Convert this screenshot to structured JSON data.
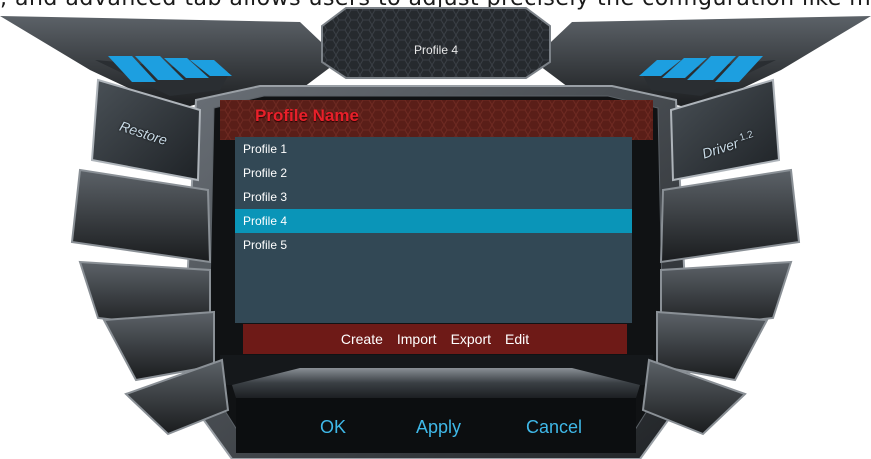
{
  "top_partial_text": ", and advanced tab allows users to adjust precisely the configuration like mouse polling rate, key respond time, cursor p",
  "header": {
    "active_profile": "Profile 4"
  },
  "left_buttons": {
    "restore_label": "Restore"
  },
  "right_buttons": {
    "driver_label": "Driver",
    "driver_version": "1.2"
  },
  "panel": {
    "title": "Profile Name",
    "profiles": [
      "Profile 1",
      "Profile 2",
      "Profile 3",
      "Profile 4",
      "Profile 5"
    ],
    "selected": "Profile 4"
  },
  "actions": {
    "create": "Create",
    "import": "Import",
    "export": "Export",
    "edit": "Edit"
  },
  "footer": {
    "ok": "OK",
    "apply": "Apply",
    "cancel": "Cancel"
  },
  "colors": {
    "accent_blue": "#3fb8e8",
    "title_red": "#e8202a",
    "selection": "#0a95b8",
    "list_bg": "#324855",
    "action_bar": "#6e1a17"
  }
}
